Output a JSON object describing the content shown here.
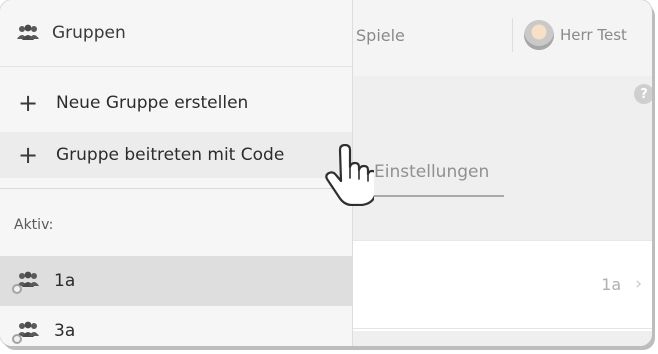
{
  "drawer": {
    "title": "Gruppen",
    "menu": [
      {
        "label": "Neue Gruppe erstellen"
      },
      {
        "label": "Gruppe beitreten mit Code"
      }
    ],
    "section_label": "Aktiv:",
    "groups": [
      {
        "name": "1a",
        "active": true
      },
      {
        "name": "3a",
        "active": false
      }
    ]
  },
  "header": {
    "tab_label": "Spiele",
    "user_name": "Herr Test",
    "help": "?"
  },
  "content": {
    "tab_label": "Einstellungen",
    "row_value": "1a",
    "chevron": "›"
  },
  "icons": {
    "group": "group-icon",
    "add": "plus-icon",
    "cursor": "hand-pointer-icon"
  }
}
